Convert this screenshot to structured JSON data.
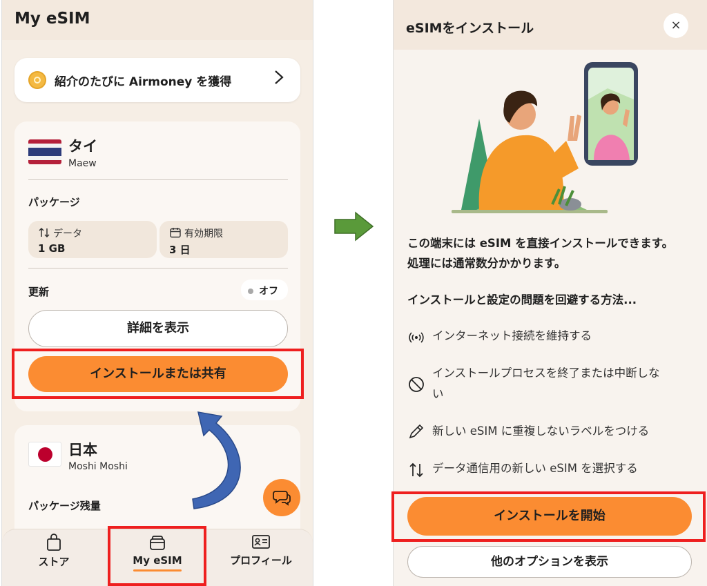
{
  "left_screen": {
    "app_title": "My eSIM",
    "referral": {
      "text": "紹介のたびに Airmoney を獲得"
    },
    "plan_thailand": {
      "country": "タイ",
      "name": "Maew",
      "package_label": "パッケージ",
      "data_label": "データ",
      "data_value": "1 GB",
      "validity_label": "有効期限",
      "validity_value": "3 日",
      "renew_label": "更新",
      "renew_toggle": "オフ",
      "details_button": "詳細を表示",
      "install_button": "インストールまたは共有"
    },
    "plan_japan": {
      "country": "日本",
      "name": "Moshi Moshi",
      "remaining_label": "パッケージ残量"
    },
    "nav": {
      "store": "ストア",
      "my_esim": "My eSIM",
      "profile": "プロフィール"
    }
  },
  "right_screen": {
    "title": "eSIMをインストール",
    "close_label": "×",
    "intro": "この端末には eSIM を直接インストールできます。処理には通常数分かかります。",
    "tips_heading": "インストールと設定の問題を回避する方法...",
    "tips": [
      "インターネット接続を維持する",
      "インストールプロセスを終了または中断しない",
      "新しい eSIM に重複しないラベルをつける",
      "データ通信用の新しい eSIM を選択する"
    ],
    "start_button": "インストールを開始",
    "more_button": "他のオプションを表示"
  },
  "colors": {
    "accent": "#fb8c32",
    "highlight": "#ee1f1f",
    "flow_arrow": "#5a9a3a",
    "curve_arrow": "#3f66b3"
  }
}
